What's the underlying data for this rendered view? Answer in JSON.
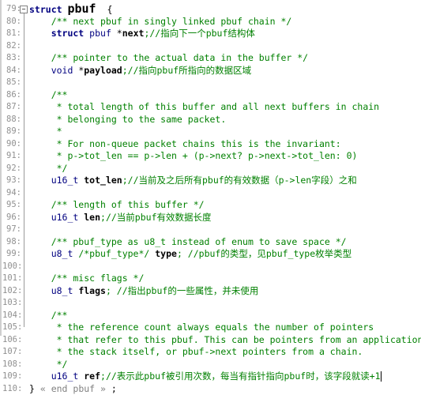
{
  "lines": [
    {
      "n": "79",
      "parts": [
        [
          "kw",
          "struct "
        ],
        [
          "big",
          "pbuf"
        ],
        [
          "",
          "  {"
        ]
      ]
    },
    {
      "n": "80",
      "parts": [
        [
          "cm",
          "    /** next pbuf in singly linked pbuf chain */"
        ]
      ]
    },
    {
      "n": "81",
      "parts": [
        [
          "kw",
          "    struct "
        ],
        [
          "ty",
          "pbuf "
        ],
        [
          "",
          "*"
        ],
        [
          "id",
          "next"
        ],
        [
          "cm",
          ";//指向下一个pbuf结构体"
        ]
      ]
    },
    {
      "n": "82",
      "parts": [
        [
          "",
          ""
        ]
      ]
    },
    {
      "n": "83",
      "parts": [
        [
          "cm",
          "    /** pointer to the actual data in the buffer */"
        ]
      ]
    },
    {
      "n": "84",
      "parts": [
        [
          "ty",
          "    void "
        ],
        [
          "",
          "*"
        ],
        [
          "id",
          "payload"
        ],
        [
          "cm",
          ";//指向pbuf所指向的数据区域"
        ]
      ]
    },
    {
      "n": "85",
      "parts": [
        [
          "",
          ""
        ]
      ]
    },
    {
      "n": "86",
      "parts": [
        [
          "cm",
          "    /**"
        ]
      ]
    },
    {
      "n": "87",
      "parts": [
        [
          "cm",
          "     * total length of this buffer and all next buffers in chain"
        ]
      ]
    },
    {
      "n": "88",
      "parts": [
        [
          "cm",
          "     * belonging to the same packet."
        ]
      ]
    },
    {
      "n": "89",
      "parts": [
        [
          "cm",
          "     *"
        ]
      ]
    },
    {
      "n": "90",
      "parts": [
        [
          "cm",
          "     * For non-queue packet chains this is the invariant:"
        ]
      ]
    },
    {
      "n": "91",
      "parts": [
        [
          "cm",
          "     * p->tot_len == p->len + (p->next? p->next->tot_len: 0)"
        ]
      ]
    },
    {
      "n": "92",
      "parts": [
        [
          "cm",
          "     */"
        ]
      ]
    },
    {
      "n": "93",
      "parts": [
        [
          "ty",
          "    u16_t "
        ],
        [
          "id",
          "tot_len"
        ],
        [
          "cm",
          ";//当前及之后所有pbuf的有效数据（p->len字段）之和"
        ]
      ]
    },
    {
      "n": "94",
      "parts": [
        [
          "",
          ""
        ]
      ]
    },
    {
      "n": "95",
      "parts": [
        [
          "cm",
          "    /** length of this buffer */"
        ]
      ]
    },
    {
      "n": "96",
      "parts": [
        [
          "ty",
          "    u16_t "
        ],
        [
          "id",
          "len"
        ],
        [
          "cm",
          ";//当前pbuf有效数据长度"
        ]
      ]
    },
    {
      "n": "97",
      "parts": [
        [
          "",
          ""
        ]
      ]
    },
    {
      "n": "98",
      "parts": [
        [
          "cm",
          "    /** pbuf_type as u8_t instead of enum to save space */"
        ]
      ]
    },
    {
      "n": "99",
      "parts": [
        [
          "ty",
          "    u8_t "
        ],
        [
          "cm",
          "/*pbuf_type*/ "
        ],
        [
          "id",
          "type"
        ],
        [
          "cm",
          "; //pbuf的类型，见pbuf_type枚举类型"
        ]
      ]
    },
    {
      "n": "100",
      "parts": [
        [
          "",
          ""
        ]
      ]
    },
    {
      "n": "101",
      "parts": [
        [
          "cm",
          "    /** misc flags */"
        ]
      ]
    },
    {
      "n": "102",
      "parts": [
        [
          "ty",
          "    u8_t "
        ],
        [
          "id",
          "flags"
        ],
        [
          "cm",
          "; //指出pbuf的一些属性，并未使用"
        ]
      ]
    },
    {
      "n": "103",
      "parts": [
        [
          "",
          ""
        ]
      ]
    },
    {
      "n": "104",
      "parts": [
        [
          "cm",
          "    /**"
        ]
      ]
    },
    {
      "n": "105",
      "parts": [
        [
          "cm",
          "     * the reference count always equals the number of pointers"
        ]
      ]
    },
    {
      "n": "106",
      "parts": [
        [
          "cm",
          "     * that refer to this pbuf. This can be pointers from an application,"
        ]
      ]
    },
    {
      "n": "107",
      "parts": [
        [
          "cm",
          "     * the stack itself, or pbuf->next pointers from a chain."
        ]
      ]
    },
    {
      "n": "108",
      "parts": [
        [
          "cm",
          "     */"
        ]
      ]
    },
    {
      "n": "109",
      "parts": [
        [
          "ty",
          "    u16_t "
        ],
        [
          "id",
          "ref"
        ],
        [
          "cm",
          ";//表示此pbuf被引用次数，每当有指针指向pbuf时，该字段就读+1"
        ]
      ]
    },
    {
      "n": "110",
      "parts": [
        [
          "",
          "} "
        ],
        [
          "end-comment",
          "« end pbuf » "
        ],
        [
          "",
          ";"
        ]
      ]
    }
  ]
}
